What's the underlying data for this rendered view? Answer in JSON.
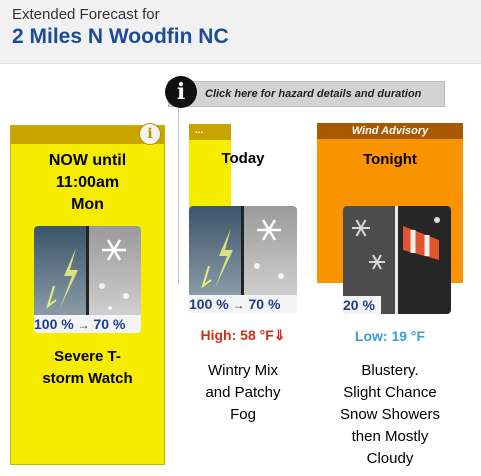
{
  "header": {
    "subtitle": "Extended Forecast for",
    "location": "2 Miles N Woodfin NC"
  },
  "hazard": {
    "info_glyph": "i",
    "text": "Click here for hazard details and duration"
  },
  "periods": [
    {
      "name": "NOW until\n11:00am\nMon",
      "description": "Severe T-\nstorm Watch",
      "info_glyph": "i",
      "pop_left": "100 %",
      "pop_arrow": "→",
      "pop_right": "70 %",
      "color": "#f6ec00"
    },
    {
      "name": "Today",
      "bar_label": "...",
      "temp": "High: 58 °F⇓",
      "description": "Wintry Mix\nand Patchy\nFog",
      "pop_left": "100 %",
      "pop_arrow": "→",
      "pop_right": "70 %",
      "temp_color": "#d12d18"
    },
    {
      "name": "Tonight",
      "bar_label": "Wind Advisory",
      "temp": "Low: 19 °F",
      "description": "Blustery.\nSlight Chance\nSnow Showers\nthen Mostly\nCloudy",
      "pop": "20 %",
      "color": "#f99400",
      "temp_color": "#3a9ed6"
    }
  ],
  "icons": {
    "p0": "thunderstorm-snow-icon",
    "p1": "thunderstorm-snow-icon",
    "p2": "snow-windsock-icon"
  }
}
